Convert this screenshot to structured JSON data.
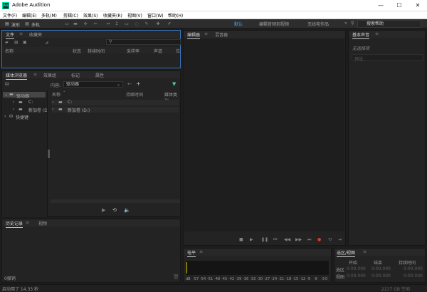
{
  "window": {
    "title": "Adobe Audition",
    "app_icon": "Au",
    "minimize": "—",
    "maximize": "☐",
    "close": "✕"
  },
  "menu": [
    "文件(F)",
    "编辑(E)",
    "多轨(M)",
    "剪辑(C)",
    "效果(S)",
    "收藏夹(R)",
    "视图(V)",
    "窗口(W)",
    "帮助(H)"
  ],
  "toolbar": {
    "waveform_label": "波形",
    "multitrack_label": "多轨"
  },
  "workspaces": [
    "默认",
    "编辑音频到视频",
    "无线电作品"
  ],
  "search": {
    "placeholder": "搜索帮助"
  },
  "files_panel": {
    "tabs": [
      "文件",
      "收藏夹"
    ],
    "columns": [
      "名称",
      "状态",
      "持续时间",
      "采样率",
      "声道",
      "位"
    ]
  },
  "media_panel": {
    "tabs": [
      "媒体浏览器",
      "效果组",
      "标记",
      "属性"
    ],
    "content_label": "内容:",
    "content_value": "驱动器",
    "columns": [
      "名称",
      "持续时间",
      "媒体类型"
    ],
    "tree": [
      "驱动器",
      "C:",
      "新加卷 (D:)",
      "快捷键"
    ],
    "list": [
      "C:",
      "新加卷 (D:)"
    ]
  },
  "editor_panel": {
    "tabs": [
      "编辑器",
      "混音器"
    ]
  },
  "essential_panel": {
    "title": "基本声音",
    "no_selection": "无选择项",
    "preset_label": "预设:"
  },
  "history_panel": {
    "tabs": [
      "历史记录",
      "视频"
    ],
    "undo": "0撤销"
  },
  "level_panel": {
    "title": "电平",
    "scale": [
      "dB",
      "-57",
      "-54",
      "-51",
      "-48",
      "-45",
      "-42",
      "-39",
      "-36",
      "-33",
      "-30",
      "-27",
      "-24",
      "-21",
      "-18",
      "-15",
      "-12",
      "-9",
      "-6",
      "-3",
      "0"
    ]
  },
  "selection_panel": {
    "title": "选区/视图",
    "headers": [
      "开始",
      "结束",
      "持续时间"
    ],
    "rows": [
      {
        "label": "选区",
        "start": "0:00.000",
        "end": "0:00.000",
        "duration": "0:00.000"
      },
      {
        "label": "视图",
        "start": "0:00.000",
        "end": "0:00.000",
        "duration": "0:00.000"
      }
    ]
  },
  "status": {
    "text": "启动用了 14.33 秒",
    "right": "2237 GB 空闲"
  }
}
